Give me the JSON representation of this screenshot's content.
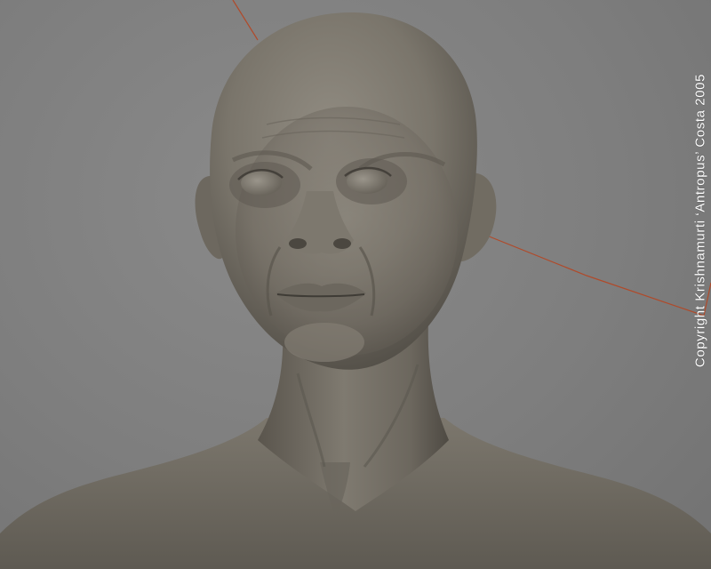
{
  "image": {
    "subject": "sculpted-bust",
    "colors": {
      "background": "#7d7d7d",
      "clay_light": "#8c877d",
      "clay_mid": "#6f6a60",
      "clay_dark": "#4a463f",
      "guide_line": "#b04a2a",
      "copyright_text": "#ffffff"
    }
  },
  "copyright": {
    "text": "Copyright Krishnamurti ‘Antropus’ Costa 2005"
  }
}
